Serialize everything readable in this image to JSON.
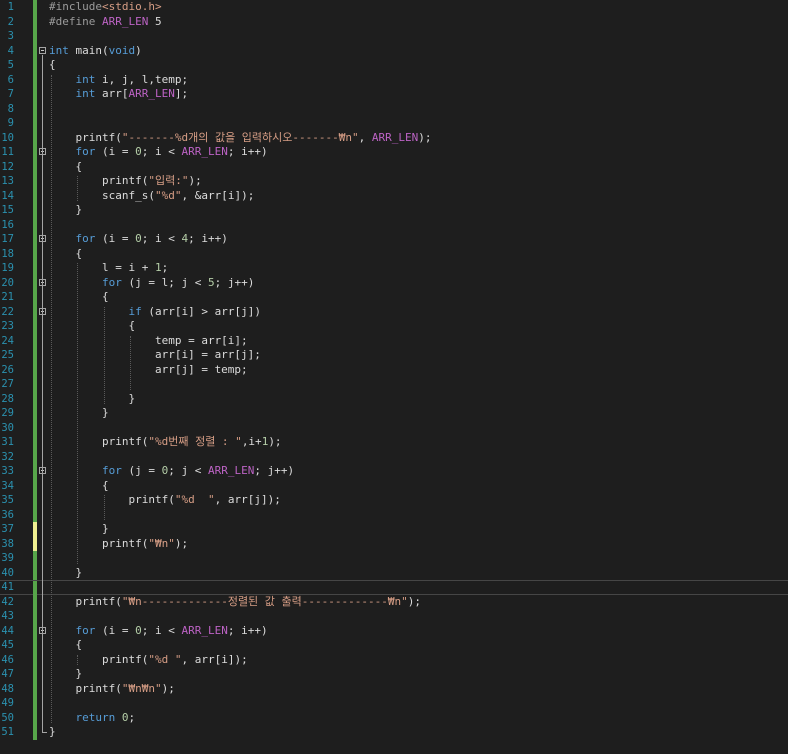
{
  "colors": {
    "background": "#1e1e1e",
    "line_number": "#2b91af",
    "keyword": "#569cd6",
    "preprocessor": "#9b9b9b",
    "macro": "#bd63c5",
    "string": "#d69d85",
    "number": "#b5cea8",
    "saved_change": "#57a64a",
    "unsaved_change": "#efef91"
  },
  "lines": [
    {
      "n": "1",
      "tokens": [
        [
          "pp",
          "#include"
        ],
        [
          "str",
          "<stdio.h>"
        ]
      ]
    },
    {
      "n": "2",
      "tokens": [
        [
          "pp",
          "#define "
        ],
        [
          "mac",
          "ARR_LEN"
        ],
        [
          "var",
          " 5"
        ]
      ]
    },
    {
      "n": "3",
      "tokens": []
    },
    {
      "n": "4",
      "tokens": [
        [
          "kw",
          "int"
        ],
        [
          "var",
          " main("
        ],
        [
          "kw",
          "void"
        ],
        [
          "var",
          ")"
        ]
      ]
    },
    {
      "n": "5",
      "tokens": [
        [
          "var",
          "{"
        ]
      ]
    },
    {
      "n": "6",
      "tokens": [
        [
          "var",
          "    "
        ],
        [
          "kw",
          "int"
        ],
        [
          "var",
          " i, j, l,temp;"
        ]
      ]
    },
    {
      "n": "7",
      "tokens": [
        [
          "var",
          "    "
        ],
        [
          "kw",
          "int"
        ],
        [
          "var",
          " arr["
        ],
        [
          "mac",
          "ARR_LEN"
        ],
        [
          "var",
          "];"
        ]
      ]
    },
    {
      "n": "8",
      "tokens": []
    },
    {
      "n": "9",
      "tokens": []
    },
    {
      "n": "10",
      "tokens": [
        [
          "var",
          "    printf("
        ],
        [
          "str",
          "\"-------%d개의 값을 입력하시오-------₩n\""
        ],
        [
          "var",
          ", "
        ],
        [
          "mac",
          "ARR_LEN"
        ],
        [
          "var",
          ");"
        ]
      ]
    },
    {
      "n": "11",
      "tokens": [
        [
          "var",
          "    "
        ],
        [
          "kw",
          "for"
        ],
        [
          "var",
          " (i = "
        ],
        [
          "num",
          "0"
        ],
        [
          "var",
          "; i < "
        ],
        [
          "mac",
          "ARR_LEN"
        ],
        [
          "var",
          "; i++)"
        ]
      ]
    },
    {
      "n": "12",
      "tokens": [
        [
          "var",
          "    {"
        ]
      ]
    },
    {
      "n": "13",
      "tokens": [
        [
          "var",
          "        printf("
        ],
        [
          "str",
          "\"입력:\""
        ],
        [
          "var",
          ");"
        ]
      ]
    },
    {
      "n": "14",
      "tokens": [
        [
          "var",
          "        scanf_s("
        ],
        [
          "str",
          "\"%d\""
        ],
        [
          "var",
          ", &arr[i]);"
        ]
      ]
    },
    {
      "n": "15",
      "tokens": [
        [
          "var",
          "    }"
        ]
      ]
    },
    {
      "n": "16",
      "tokens": []
    },
    {
      "n": "17",
      "tokens": [
        [
          "var",
          "    "
        ],
        [
          "kw",
          "for"
        ],
        [
          "var",
          " (i = "
        ],
        [
          "num",
          "0"
        ],
        [
          "var",
          "; i < "
        ],
        [
          "num",
          "4"
        ],
        [
          "var",
          "; i++)"
        ]
      ]
    },
    {
      "n": "18",
      "tokens": [
        [
          "var",
          "    {"
        ]
      ]
    },
    {
      "n": "19",
      "tokens": [
        [
          "var",
          "        l = i + "
        ],
        [
          "num",
          "1"
        ],
        [
          "var",
          ";"
        ]
      ]
    },
    {
      "n": "20",
      "tokens": [
        [
          "var",
          "        "
        ],
        [
          "kw",
          "for"
        ],
        [
          "var",
          " (j = l; j < "
        ],
        [
          "num",
          "5"
        ],
        [
          "var",
          "; j++)"
        ]
      ]
    },
    {
      "n": "21",
      "tokens": [
        [
          "var",
          "        {"
        ]
      ]
    },
    {
      "n": "22",
      "tokens": [
        [
          "var",
          "            "
        ],
        [
          "kw",
          "if"
        ],
        [
          "var",
          " (arr[i] > arr[j])"
        ]
      ]
    },
    {
      "n": "23",
      "tokens": [
        [
          "var",
          "            {"
        ]
      ]
    },
    {
      "n": "24",
      "tokens": [
        [
          "var",
          "                temp = arr[i];"
        ]
      ]
    },
    {
      "n": "25",
      "tokens": [
        [
          "var",
          "                arr[i] = arr[j];"
        ]
      ]
    },
    {
      "n": "26",
      "tokens": [
        [
          "var",
          "                arr[j] = temp;"
        ]
      ]
    },
    {
      "n": "27",
      "tokens": []
    },
    {
      "n": "28",
      "tokens": [
        [
          "var",
          "            }"
        ]
      ]
    },
    {
      "n": "29",
      "tokens": [
        [
          "var",
          "        }"
        ]
      ]
    },
    {
      "n": "30",
      "tokens": []
    },
    {
      "n": "31",
      "tokens": [
        [
          "var",
          "        printf("
        ],
        [
          "str",
          "\"%d번째 정렬 : \""
        ],
        [
          "var",
          ",i+"
        ],
        [
          "num",
          "1"
        ],
        [
          "var",
          ");"
        ]
      ]
    },
    {
      "n": "32",
      "tokens": []
    },
    {
      "n": "33",
      "tokens": [
        [
          "var",
          "        "
        ],
        [
          "kw",
          "for"
        ],
        [
          "var",
          " (j = "
        ],
        [
          "num",
          "0"
        ],
        [
          "var",
          "; j < "
        ],
        [
          "mac",
          "ARR_LEN"
        ],
        [
          "var",
          "; j++)"
        ]
      ]
    },
    {
      "n": "34",
      "tokens": [
        [
          "var",
          "        {"
        ]
      ]
    },
    {
      "n": "35",
      "tokens": [
        [
          "var",
          "            printf("
        ],
        [
          "str",
          "\"%d  \""
        ],
        [
          "var",
          ", arr[j]);"
        ]
      ]
    },
    {
      "n": "36",
      "tokens": []
    },
    {
      "n": "37",
      "tokens": [
        [
          "var",
          "        }"
        ]
      ]
    },
    {
      "n": "38",
      "tokens": [
        [
          "var",
          "        printf("
        ],
        [
          "str",
          "\"₩n\""
        ],
        [
          "var",
          ");"
        ]
      ]
    },
    {
      "n": "39",
      "tokens": []
    },
    {
      "n": "40",
      "tokens": [
        [
          "var",
          "    }"
        ]
      ]
    },
    {
      "n": "41",
      "tokens": []
    },
    {
      "n": "42",
      "tokens": [
        [
          "var",
          "    printf("
        ],
        [
          "str",
          "\"₩n-------------정렬된 값 출력-------------₩n\""
        ],
        [
          "var",
          ");"
        ]
      ]
    },
    {
      "n": "43",
      "tokens": []
    },
    {
      "n": "44",
      "tokens": [
        [
          "var",
          "    "
        ],
        [
          "kw",
          "for"
        ],
        [
          "var",
          " (i = "
        ],
        [
          "num",
          "0"
        ],
        [
          "var",
          "; i < "
        ],
        [
          "mac",
          "ARR_LEN"
        ],
        [
          "var",
          "; i++)"
        ]
      ]
    },
    {
      "n": "45",
      "tokens": [
        [
          "var",
          "    {"
        ]
      ]
    },
    {
      "n": "46",
      "tokens": [
        [
          "var",
          "        printf("
        ],
        [
          "str",
          "\"%d \""
        ],
        [
          "var",
          ", arr[i]);"
        ]
      ]
    },
    {
      "n": "47",
      "tokens": [
        [
          "var",
          "    }"
        ]
      ]
    },
    {
      "n": "48",
      "tokens": [
        [
          "var",
          "    printf("
        ],
        [
          "str",
          "\"₩n₩n\""
        ],
        [
          "var",
          ");"
        ]
      ]
    },
    {
      "n": "49",
      "tokens": []
    },
    {
      "n": "50",
      "tokens": [
        [
          "var",
          "    "
        ],
        [
          "kw",
          "return"
        ],
        [
          "var",
          " "
        ],
        [
          "num",
          "0"
        ],
        [
          "var",
          ";"
        ]
      ]
    },
    {
      "n": "51",
      "tokens": [
        [
          "var",
          "}"
        ]
      ]
    }
  ]
}
